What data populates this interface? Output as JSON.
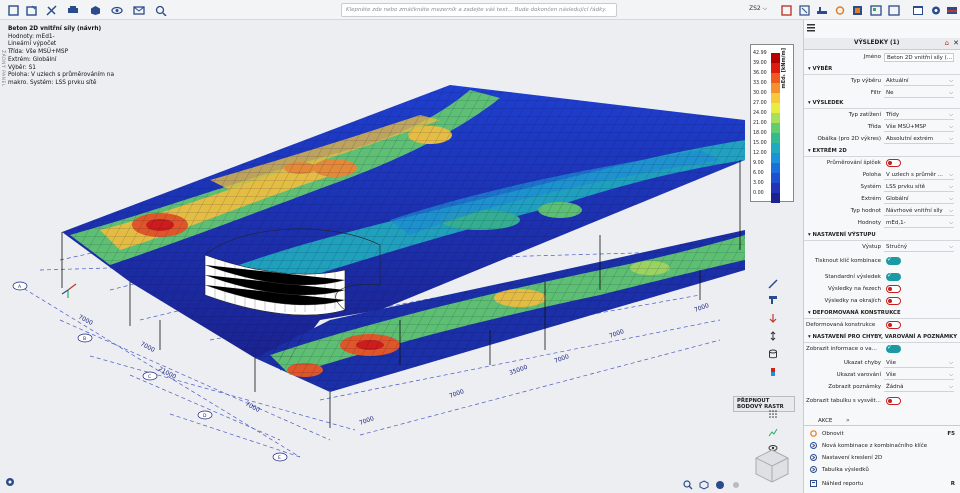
{
  "command_line": {
    "placeholder": "Klepněte zde nebo zmáčkněte mezerník a zadejte váš text... Bude dokončen následující řádky."
  },
  "toolbar": {
    "coord_system": "ZS2"
  },
  "viewport": {
    "side_label": "ŽÁDNÝ PANEL",
    "info": {
      "title": "Beton 2D vnitřní síly (návrh)",
      "values": "Hodnoty: mEd1-",
      "calc": "Lineární výpočet",
      "class": "Třída: Vše MSÚ+MSP",
      "extreme": "Extrém: Globální",
      "selection": "Výběr: S1",
      "position": "Poloha: V uzlech s průměrováním na",
      "position2": "makro. Systém: LSS prvku sítě"
    },
    "legend": {
      "unit": "mEd₁ [kNm/m]",
      "values": [
        "42.99",
        "39.00",
        "36.00",
        "33.00",
        "30.00",
        "27.00",
        "24.00",
        "21.00",
        "18.00",
        "15.00",
        "12.00",
        "9.00",
        "6.00",
        "3.00",
        "0.00"
      ],
      "colors": [
        "#b40000",
        "#dd1b0f",
        "#f05a1e",
        "#f5912d",
        "#f6c93a",
        "#e6ee42",
        "#a8e05a",
        "#63cc6e",
        "#35b98f",
        "#20aabf",
        "#1c93d8",
        "#1a6fdc",
        "#1e4fd0",
        "#2233b8",
        "#1a2290"
      ]
    },
    "dims": [
      "7000",
      "7000",
      "7000",
      "7000",
      "7000",
      "7000",
      "7000",
      "7000",
      "21000",
      "35000"
    ],
    "axes": [
      "A",
      "B",
      "C",
      "D",
      "E",
      "1",
      "2"
    ],
    "tooltip": "PŘEPNOUT BODOVÝ RASTR"
  },
  "panel": {
    "title": "VÝSLEDKY (1)",
    "name_label": "Jméno",
    "name_value": "Beton 2D vnitřní síly (...",
    "sections": {
      "selection": "VÝBĚR",
      "result": "VÝSLEDEK",
      "extreme2d": "EXTRÉM 2D",
      "output": "NASTAVENÍ VÝSTUPU",
      "deformed": "DEFORMOVANÁ KONSTRUKCE",
      "errors": "NASTAVENÍ PRO CHYBY, VAROVÁNÍ A POZNÁMKY"
    },
    "selection_type_label": "Typ výběru",
    "selection_type_value": "Aktuální",
    "filter_label": "Filtr",
    "filter_value": "Ne",
    "load_type_label": "Typ zatížení",
    "load_type_value": "Třídy",
    "class_label": "Třída",
    "class_value": "Vše MSÚ+MSP",
    "envelope_label": "Obálka (pro 2D výkres)",
    "envelope_value": "Absolutní extrém",
    "peak_label": "Průměrování špiček",
    "position_label": "Poloha",
    "position_value": "V uzlech s průměr ...",
    "system_label": "Systém",
    "system_value": "LSS prvku sítě",
    "extreme_label": "Extrém",
    "extreme_value": "Globální",
    "value_type_label": "Typ hodnot",
    "value_type_value": "Návrhové vnitřní síly",
    "values_label": "Hodnoty",
    "values_value": "mEd,1-",
    "output_label": "Výstup",
    "output_value": "Stručný",
    "print_combo_label": "Tisknout klíč kombinace",
    "std_result_label": "Standardní výsledek",
    "sections_result_label": "Výsledky na řezech",
    "edges_result_label": "Výsledky na okrajích",
    "deformed_label": "Deformovaná konstrukce",
    "show_info_label": "Zobrazit informace o va...",
    "errors_label": "Ukazat chyby",
    "errors_value": "Vše",
    "warnings_label": "Ukazat varování",
    "warnings_value": "Vše",
    "notes_label": "Zobrazit poznámky",
    "notes_value": "Žádná",
    "table_label": "Zobrazit tabulku s vysvět...",
    "actions_title": "AKCE",
    "actions": [
      {
        "label": "Obnovit",
        "shortcut": "F5"
      },
      {
        "label": "Nová kombinace z kombinačního klíče",
        "shortcut": ""
      },
      {
        "label": "Nastavení kreslení 2D",
        "shortcut": ""
      },
      {
        "label": "Tabulka výsledků",
        "shortcut": ""
      },
      {
        "label": "Náhled reportu",
        "shortcut": "R"
      }
    ]
  }
}
